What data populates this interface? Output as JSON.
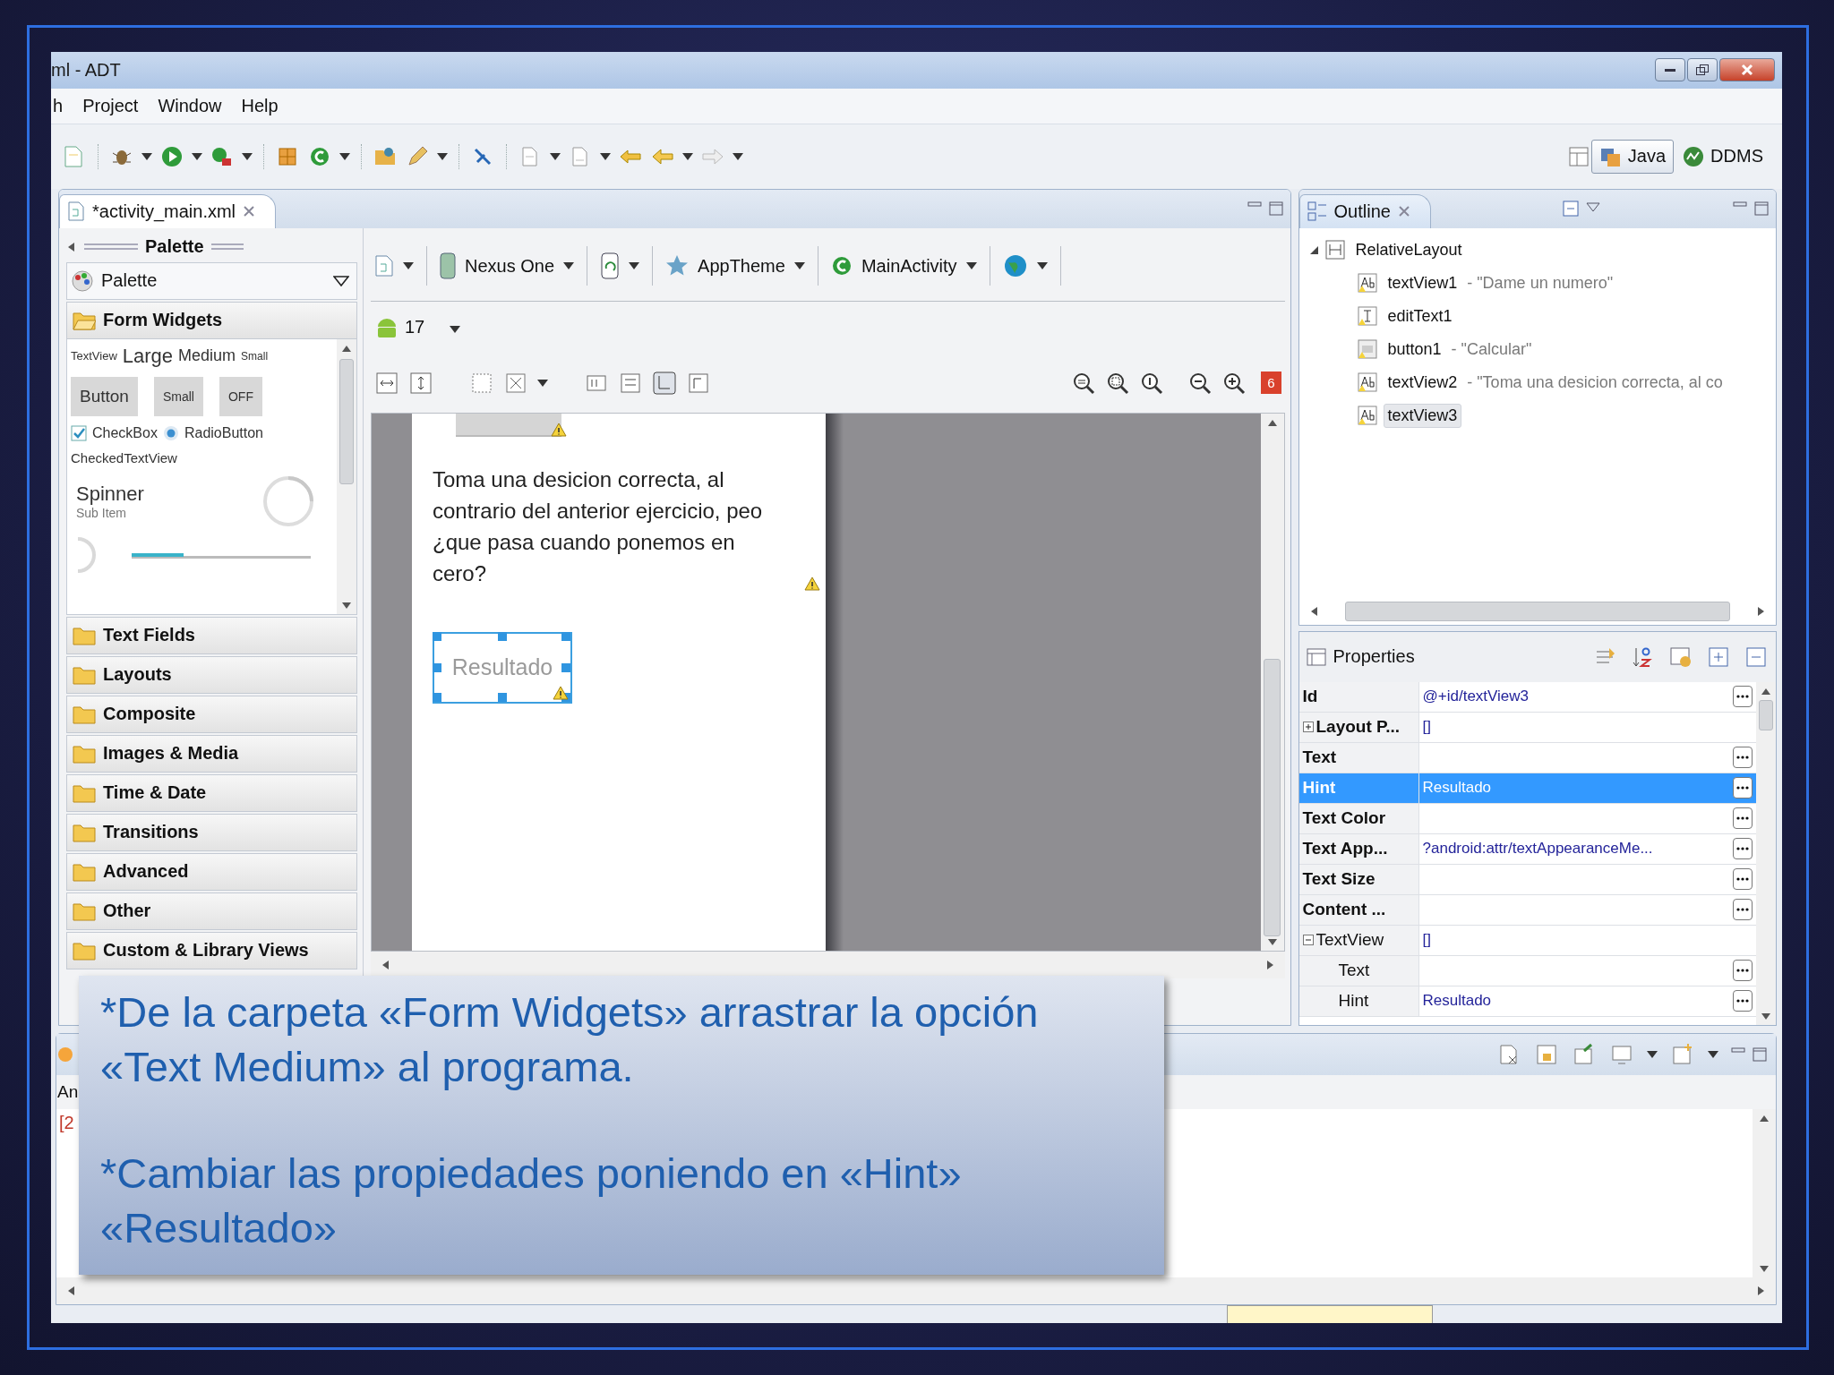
{
  "window": {
    "title": "ml - ADT"
  },
  "menu": [
    "h",
    "Project",
    "Window",
    "Help"
  ],
  "perspectives": [
    {
      "label": "Java",
      "selected": true
    },
    {
      "label": "DDMS",
      "selected": false
    }
  ],
  "editor": {
    "tab": "*activity_main.xml",
    "palette": {
      "header": "Palette",
      "selector": "Palette",
      "categories": [
        {
          "label": "Form Widgets",
          "expanded": true
        },
        {
          "label": "Text Fields",
          "expanded": false
        },
        {
          "label": "Layouts",
          "expanded": false
        },
        {
          "label": "Composite",
          "expanded": false
        },
        {
          "label": "Images & Media",
          "expanded": false
        },
        {
          "label": "Time & Date",
          "expanded": false
        },
        {
          "label": "Transitions",
          "expanded": false
        },
        {
          "label": "Advanced",
          "expanded": false
        },
        {
          "label": "Other",
          "expanded": false
        },
        {
          "label": "Custom & Library Views",
          "expanded": false
        }
      ],
      "form_widgets": {
        "text_sizes": [
          "TextView",
          "Large",
          "Medium",
          "Small"
        ],
        "buttons": [
          "Button",
          "Small",
          "OFF"
        ],
        "checkbox": {
          "label": "CheckBox",
          "checked": true
        },
        "radio": {
          "label": "RadioButton",
          "selected": true
        },
        "checked_text": "CheckedTextView",
        "spinner": {
          "title": "Spinner",
          "subtitle": "Sub Item"
        }
      }
    },
    "config": {
      "device": "Nexus One",
      "theme": "AppTheme",
      "activity": "MainActivity",
      "api_level": "17",
      "error_count": "6"
    },
    "canvas": {
      "paragraph": "Toma una desicion correcta, al contrario del anterior ejercicio, peo ¿que pasa cuando ponemos en cero?",
      "field": {
        "hint": "Resultado",
        "selected": true
      }
    }
  },
  "outline": {
    "title": "Outline",
    "tree": [
      {
        "kind": "layout",
        "name": "RelativeLayout",
        "expanded": true,
        "selected": false,
        "children": [
          {
            "kind": "text",
            "name": "textView1",
            "detail": "- \"Dame un numero\"",
            "selected": false
          },
          {
            "kind": "edit",
            "name": "editText1",
            "selected": false
          },
          {
            "kind": "button",
            "name": "button1",
            "detail": "- \"Calcular\"",
            "selected": false
          },
          {
            "kind": "text",
            "name": "textView2",
            "detail": "- \"Toma una desicion correcta, al co",
            "selected": false
          },
          {
            "kind": "text",
            "name": "textView3",
            "selected": true
          }
        ]
      }
    ]
  },
  "properties": {
    "title": "Properties",
    "rows": [
      {
        "kind": "property",
        "name": "Id",
        "value": "@+id/textView3",
        "selected": false
      },
      {
        "kind": "group",
        "name": "Layout P...",
        "value": "[]",
        "expanded": false,
        "selected": false
      },
      {
        "kind": "property",
        "name": "Text",
        "selected": false
      },
      {
        "kind": "property",
        "name": "Hint",
        "value": "Resultado",
        "selected": true
      },
      {
        "kind": "property",
        "name": "Text Color",
        "selected": false
      },
      {
        "kind": "property",
        "name": "Text App...",
        "value": "?android:attr/textAppearanceMe...",
        "selected": false
      },
      {
        "kind": "property",
        "name": "Text Size",
        "selected": false
      },
      {
        "kind": "property",
        "name": "Content ...",
        "selected": false
      },
      {
        "kind": "group",
        "name": "TextView",
        "value": "[]",
        "expanded": true,
        "selected": false,
        "children": [
          {
            "kind": "property",
            "name": "Text",
            "selected": false
          },
          {
            "kind": "property",
            "name": "Hint",
            "value": "Resultado",
            "selected": false
          }
        ]
      }
    ]
  },
  "console": {
    "tab": "An",
    "line": "[2"
  },
  "caption": {
    "paragraphs": [
      "*De la carpeta «Form Widgets» arrastrar la opción «Text Medium» al programa.",
      "*Cambiar las propiedades poniendo en «Hint» «Resultado»"
    ]
  }
}
